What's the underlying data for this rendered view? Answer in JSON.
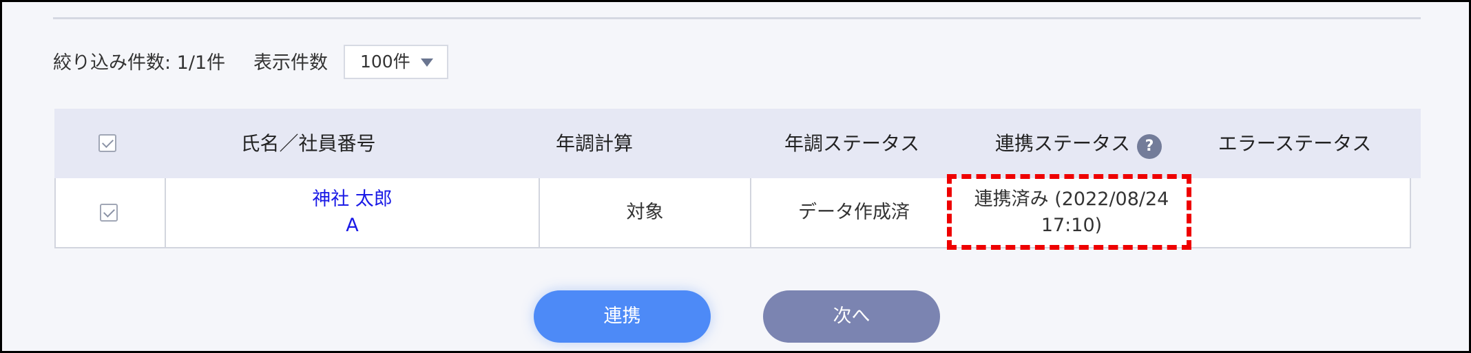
{
  "filter": {
    "count_label": "絞り込み件数: 1/1件",
    "pagesize_label": "表示件数",
    "pagesize_value": "100件"
  },
  "table": {
    "headers": {
      "name": "氏名／社員番号",
      "calc": "年調計算",
      "status": "年調ステータス",
      "link_status": "連携ステータス",
      "link_status_help": "?",
      "error_status": "エラーステータス"
    },
    "rows": [
      {
        "checked": true,
        "name": "神社 太郎",
        "employee_no": "A",
        "calc": "対象",
        "status": "データ作成済",
        "link_status_line1": "連携済み (2022/08/24",
        "link_status_line2": "17:10)",
        "error_status": ""
      }
    ]
  },
  "buttons": {
    "link": "連携",
    "next": "次へ"
  },
  "colors": {
    "primary_button": "#4d8af7",
    "secondary_button": "#7b84b1",
    "highlight": "#ee0000",
    "link_text": "#1a1ae6",
    "header_bg": "#e6e8f4"
  }
}
